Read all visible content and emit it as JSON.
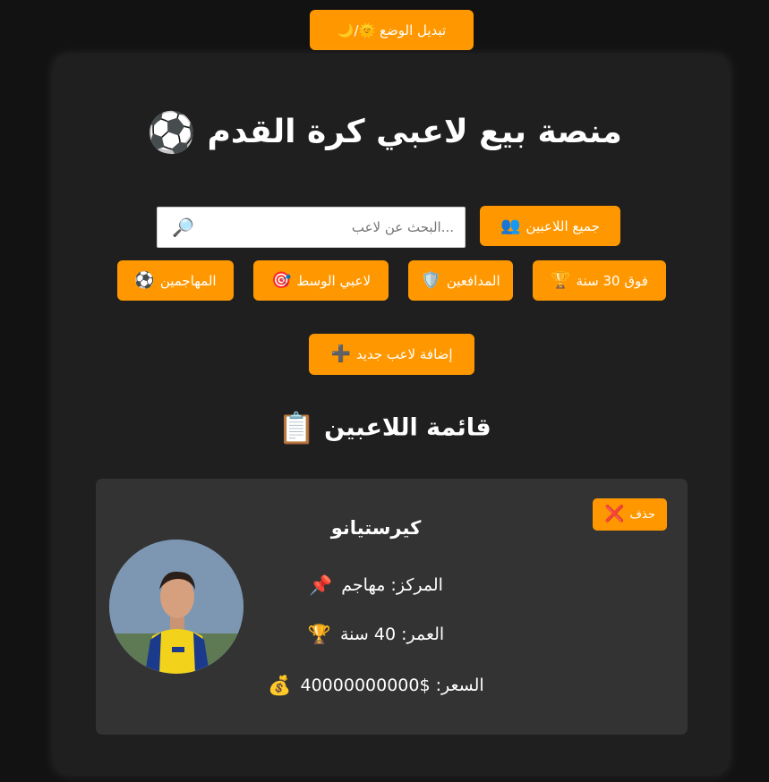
{
  "header": {
    "mode_button_label": "تبديل الوضع 🌞/🌙"
  },
  "main": {
    "title": "منصة بيع لاعبي كرة القدم",
    "title_icon": "⚽",
    "search": {
      "placeholder": "...البحث عن لاعب",
      "value": "",
      "icon": "🔎"
    },
    "filters": {
      "all": {
        "label": "جميع اللاعبين",
        "icon": "👥"
      },
      "over30": {
        "label": "فوق 30 سنة",
        "icon": "🏆"
      },
      "defenders": {
        "label": "المدافعين",
        "icon": "🛡️"
      },
      "midfielders": {
        "label": "لاعبي الوسط",
        "icon": "🎯"
      },
      "forwards": {
        "label": "المهاجمين",
        "icon": "⚽"
      }
    },
    "add_button": {
      "label": "إضافة لاعب جديد",
      "icon": "➕"
    },
    "list_title": "قائمة اللاعبين",
    "list_icon": "📋"
  },
  "players": [
    {
      "name": "كيرستيانو",
      "position": "المركز: مهاجم",
      "position_icon": "📌",
      "age": "العمر: 40 سنة",
      "age_icon": "🏆",
      "price": "السعر: $40000000000",
      "price_icon": "💰",
      "delete_label": "حذف",
      "delete_icon": "❌"
    }
  ],
  "colors": {
    "accent": "#ff9800",
    "background": "#121212",
    "container": "#1f1f1f",
    "card": "#333333",
    "text": "#ffffff"
  }
}
